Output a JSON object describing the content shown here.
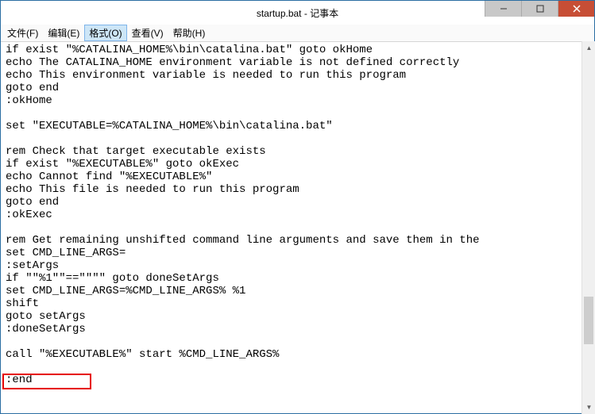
{
  "window": {
    "title": "startup.bat - 记事本"
  },
  "menu": {
    "file": "文件(F)",
    "edit": "编辑(E)",
    "format": "格式(O)",
    "view": "查看(V)",
    "help": "帮助(H)"
  },
  "editor": {
    "text": "if exist \"%CATALINA_HOME%\\bin\\catalina.bat\" goto okHome\necho The CATALINA_HOME environment variable is not defined correctly\necho This environment variable is needed to run this program\ngoto end\n:okHome\n\nset \"EXECUTABLE=%CATALINA_HOME%\\bin\\catalina.bat\"\n\nrem Check that target executable exists\nif exist \"%EXECUTABLE%\" goto okExec\necho Cannot find \"%EXECUTABLE%\"\necho This file is needed to run this program\ngoto end\n:okExec\n\nrem Get remaining unshifted command line arguments and save them in the\nset CMD_LINE_ARGS=\n:setArgs\nif \"\"%1\"\"==\"\"\"\" goto doneSetArgs\nset CMD_LINE_ARGS=%CMD_LINE_ARGS% %1\nshift\ngoto setArgs\n:doneSetArgs\n\ncall \"%EXECUTABLE%\" start %CMD_LINE_ARGS%\n\n:end"
  },
  "highlight": {
    "line": ":end"
  }
}
